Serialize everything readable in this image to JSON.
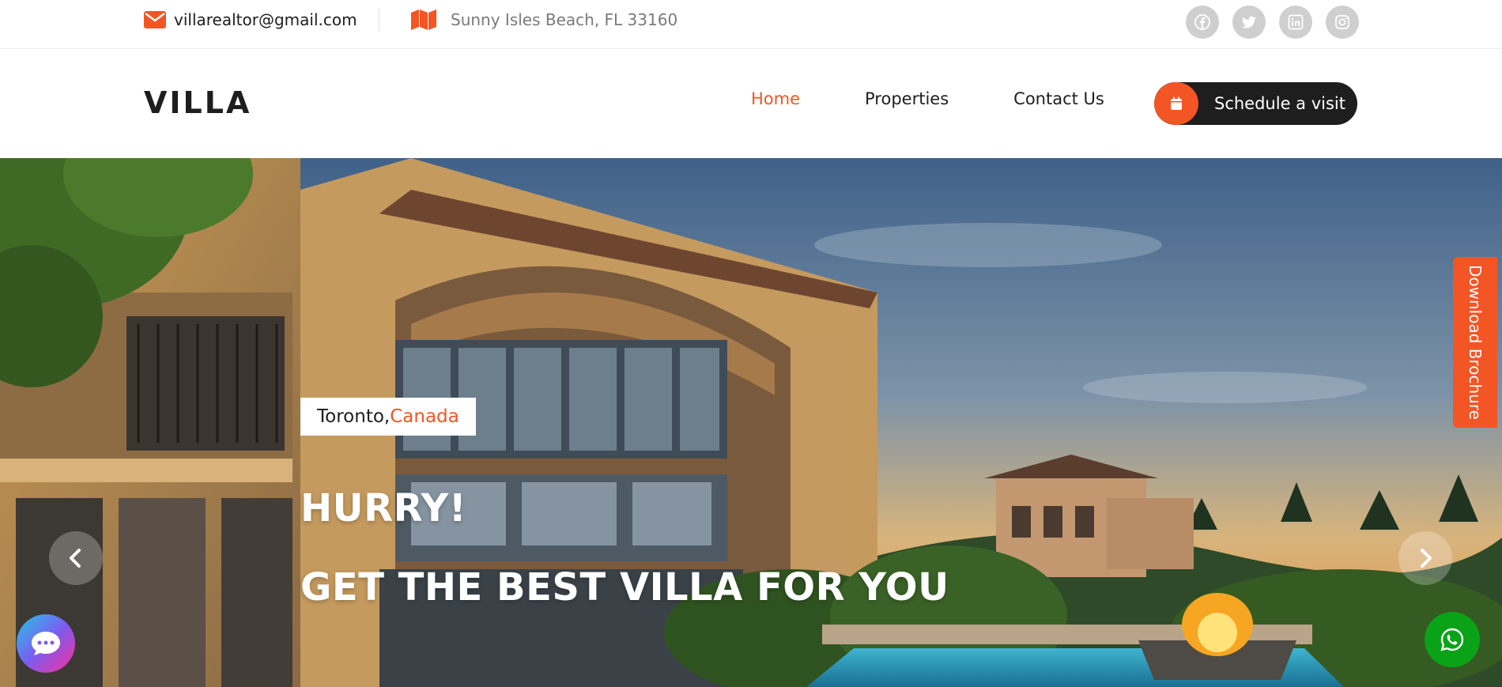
{
  "topbar": {
    "email": "villarealtor@gmail.com",
    "address": "Sunny Isles Beach, FL 33160",
    "icons": {
      "email": "envelope-icon",
      "address": "map-icon"
    },
    "socials": [
      "facebook-icon",
      "twitter-icon",
      "linkedin-icon",
      "instagram-icon"
    ]
  },
  "header": {
    "logo": "VILLA",
    "nav": [
      {
        "label": "Home",
        "active": true
      },
      {
        "label": "Properties",
        "active": false
      },
      {
        "label": "Contact Us",
        "active": false
      }
    ],
    "cta": {
      "label": "Schedule a visit",
      "icon": "calendar-icon"
    }
  },
  "hero": {
    "badge": {
      "city": "Toronto, ",
      "country": "Canada"
    },
    "title_line1": "HURRY!",
    "title_line2": "GET THE BEST VILLA FOR YOU",
    "prev_icon": "chevron-left-icon",
    "next_icon": "chevron-right-icon"
  },
  "side_tab": {
    "label": "Download Brochure"
  },
  "floating": {
    "chat_icon": "chat-bubble-icon",
    "whatsapp_icon": "whatsapp-icon"
  },
  "colors": {
    "accent": "#f35525",
    "dark": "#1e1e1e",
    "whatsapp": "#0aa318"
  }
}
